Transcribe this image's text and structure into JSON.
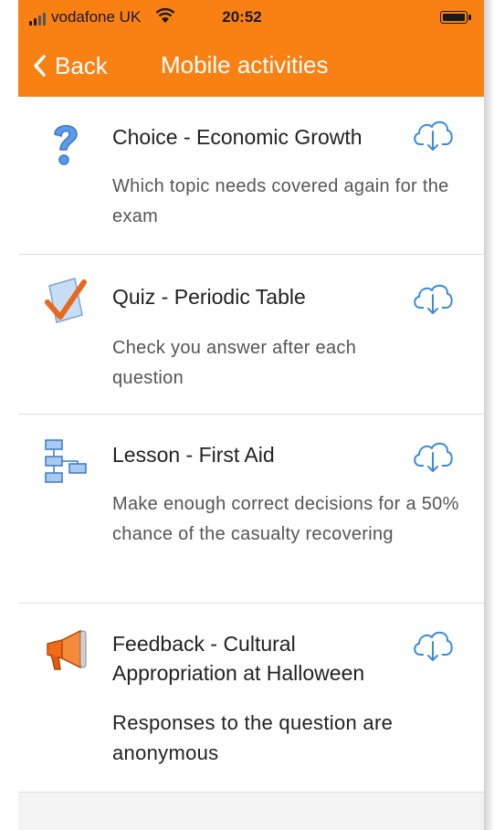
{
  "status": {
    "carrier": "vodafone UK",
    "time": "20:52"
  },
  "nav": {
    "back_label": "Back",
    "title": "Mobile activities"
  },
  "activities": [
    {
      "icon": "question-icon",
      "title": "Choice - Economic Growth",
      "description": "Which topic needs covered again for the exam"
    },
    {
      "icon": "quiz-checkmark-icon",
      "title": "Quiz - Periodic Table",
      "description": "Check you answer after each question"
    },
    {
      "icon": "lesson-flowchart-icon",
      "title": "Lesson - First Aid",
      "description": "Make enough correct decisions for a 50% chance of the casualty recovering"
    },
    {
      "icon": "megaphone-icon",
      "title": "Feedback - Cultural Appropriation at Halloween",
      "description": "Responses to the question are anonymous"
    }
  ],
  "colors": {
    "header": "#f98012",
    "icon_blue": "#3a8be0"
  }
}
